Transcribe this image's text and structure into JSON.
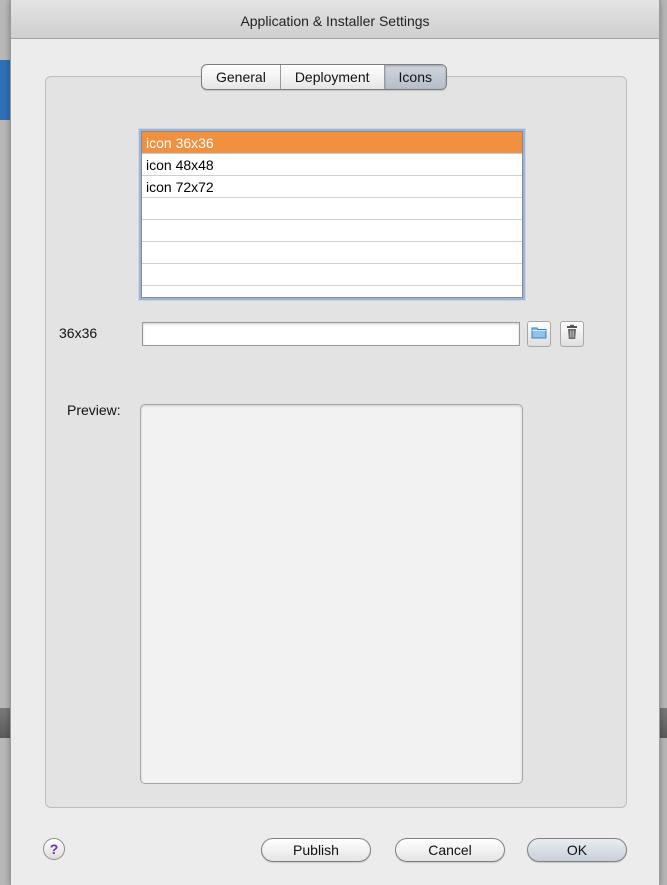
{
  "window": {
    "title": "Application & Installer Settings"
  },
  "tabs": [
    {
      "label": "General",
      "selected": false
    },
    {
      "label": "Deployment",
      "selected": false
    },
    {
      "label": "Icons",
      "selected": true
    }
  ],
  "icon_list": {
    "items": [
      {
        "label": "icon 36x36",
        "selected": true
      },
      {
        "label": "icon 48x48",
        "selected": false
      },
      {
        "label": "icon 72x72",
        "selected": false
      }
    ],
    "selection_color": "#f1903f"
  },
  "icon_path": {
    "label": "36x36",
    "value": "",
    "browse_icon": "folder-icon",
    "delete_icon": "trash-icon"
  },
  "preview": {
    "label": "Preview:"
  },
  "footer": {
    "help_label": "?",
    "publish_label": "Publish",
    "cancel_label": "Cancel",
    "ok_label": "OK"
  }
}
